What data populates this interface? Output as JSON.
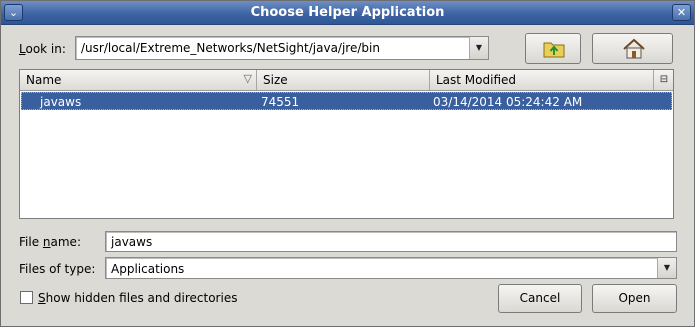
{
  "window": {
    "title": "Choose Helper Application"
  },
  "look_in": {
    "label": "Look in:",
    "path": "/usr/local/Extreme_Networks/NetSight/java/jre/bin"
  },
  "icons": {
    "up_folder": "folder-up-icon",
    "home": "home-icon"
  },
  "table": {
    "columns": [
      "Name",
      "Size",
      "Last Modified"
    ],
    "rows": [
      {
        "name": "javaws",
        "size": "74551",
        "modified": "03/14/2014 05:24:42 AM",
        "selected": true
      }
    ]
  },
  "file_name": {
    "label": "File name:",
    "value": "javaws"
  },
  "file_type": {
    "label": "Files of type:",
    "value": "Applications"
  },
  "show_hidden": {
    "label": "Show hidden files and directories",
    "checked": false
  },
  "buttons": {
    "cancel": "Cancel",
    "open": "Open"
  },
  "colors": {
    "title_bar": "#3f64a4",
    "selection": "#3a5f9f",
    "background": "#dcdad5"
  }
}
